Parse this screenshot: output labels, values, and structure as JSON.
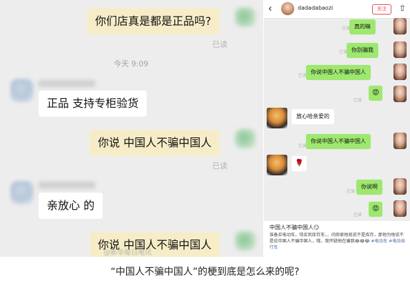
{
  "left_chat": {
    "msg_1": "你们店真是都是正品吗?",
    "read_1": "已读",
    "time": "今天 9:09",
    "msg_2": "正品 支持专柜验货",
    "msg_3": "你说 中国人不骗中国人",
    "read_2": "已读",
    "msg_4": "亲放心 的",
    "msg_5": "你说 中国人不骗中国人",
    "watermark": "@新华每日电讯"
  },
  "right_phone": {
    "header": {
      "back_glyph": "‹",
      "username": "dadadabaozi",
      "follow_label": "关注",
      "share_glyph": "⇧"
    },
    "messages": [
      {
        "side": "out",
        "text": "真的嘛",
        "read": "已读"
      },
      {
        "side": "out",
        "text": "你别骗我",
        "read": "已读"
      },
      {
        "side": "out",
        "text": "你说中国人不骗中国人",
        "read": "已读"
      },
      {
        "side": "out",
        "text": "😡",
        "read": "已读"
      },
      {
        "side": "in",
        "text": "放心哈亲爱的"
      },
      {
        "side": "out",
        "text": "你说中国人不骗中国人",
        "read": "已读"
      },
      {
        "side": "in",
        "text": "🌹"
      },
      {
        "side": "out",
        "text": "你说啊",
        "read": "已读"
      },
      {
        "side": "out",
        "text": "😡",
        "read": "已读"
      }
    ],
    "post": {
      "title": "中国人不骗中国人😏",
      "body": "准备买电动车，怕买到库存车，，问商家他就说不是库存，那他为啥说不是说中国人不骗中国人，哦，我怀疑他在骗我😂😂😂",
      "tags": "#电动车 #电动自行车"
    }
  },
  "caption": "“中国人不骗中国人”的梗到底是怎么来的呢?",
  "colors": {
    "left_bg": "#ededed",
    "left_out_bubble": "#f6edc8",
    "right_out_bubble": "#9ee870",
    "follow_red": "#e84b55",
    "tag_blue": "#4a6fa5"
  }
}
